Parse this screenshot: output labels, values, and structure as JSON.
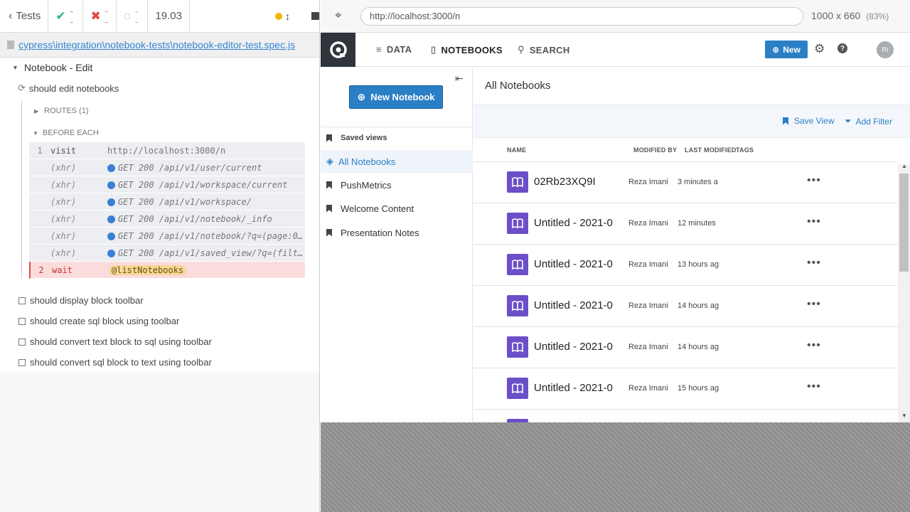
{
  "runner": {
    "tests_label": "Tests",
    "passed": "--",
    "failed": "--",
    "pending": "--",
    "duration": "19.03",
    "spec_path": "cypress\\integration\\notebook-tests\\notebook-editor-test.spec.js",
    "suite_title": "Notebook - Edit",
    "test_title": "should edit notebooks",
    "routes_label": "ROUTES (1)",
    "before_each_label": "BEFORE EACH",
    "commands": [
      {
        "num": "1",
        "name": "visit",
        "msg": "http://localhost:3000/n",
        "type": "visit"
      },
      {
        "num": "",
        "name": "(xhr)",
        "msg": "GET 200 /api/v1/user/current",
        "type": "xhr"
      },
      {
        "num": "",
        "name": "(xhr)",
        "msg": "GET 200 /api/v1/workspace/current",
        "type": "xhr"
      },
      {
        "num": "",
        "name": "(xhr)",
        "msg": "GET 200 /api/v1/workspace/",
        "type": "xhr"
      },
      {
        "num": "",
        "name": "(xhr)",
        "msg": "GET 200 /api/v1/notebook/_info",
        "type": "xhr"
      },
      {
        "num": "",
        "name": "(xhr)",
        "msg": "GET 200 /api/v1/notebook/?q=(page:0,pa…",
        "type": "xhr"
      },
      {
        "num": "",
        "name": "(xhr)",
        "msg": "GET 200 /api/v1/saved_view/?q=(filters…",
        "type": "xhr"
      },
      {
        "num": "2",
        "name": "wait",
        "msg": "@listNotebooks",
        "type": "wait"
      }
    ],
    "pending_tests": [
      "should display block toolbar",
      "should create sql block using toolbar",
      "should convert text block to sql using toolbar",
      "should convert sql block to text using toolbar"
    ]
  },
  "browser": {
    "url": "http://localhost:3000/n",
    "viewport": "1000 x 660",
    "zoom": "(83%)"
  },
  "app": {
    "nav": {
      "data": "DATA",
      "notebooks": "NOTEBOOKS",
      "search": "SEARCH"
    },
    "new_button": "New",
    "avatar": "RI",
    "new_notebook": "New Notebook",
    "saved_views_label": "Saved views",
    "sidebar_items": [
      "All Notebooks",
      "PushMetrics",
      "Welcome Content",
      "Presentation Notes"
    ],
    "page_title": "All Notebooks",
    "save_view": "Save View",
    "add_filter": "Add Filter",
    "columns": {
      "name": "NAME",
      "modified_by": "MODIFIED BY",
      "last_modified": "LAST MODIFIED",
      "tags": "TAGS"
    },
    "notebooks": [
      {
        "title": "02Rb23XQ9I",
        "by": "Reza Imani",
        "modified": "3 minutes a"
      },
      {
        "title": "Untitled - 2021-0",
        "by": "Reza Imani",
        "modified": "12 minutes"
      },
      {
        "title": "Untitled - 2021-0",
        "by": "Reza Imani",
        "modified": "13 hours ag"
      },
      {
        "title": "Untitled - 2021-0",
        "by": "Reza Imani",
        "modified": "14 hours ag"
      },
      {
        "title": "Untitled - 2021-0",
        "by": "Reza Imani",
        "modified": "14 hours ag"
      },
      {
        "title": "Untitled - 2021-0",
        "by": "Reza Imani",
        "modified": "15 hours ag"
      }
    ],
    "colors": {
      "accent": "#2b7fc4",
      "notebook_icon": "#6b4fc8",
      "logo_bg": "#2f353b"
    }
  }
}
